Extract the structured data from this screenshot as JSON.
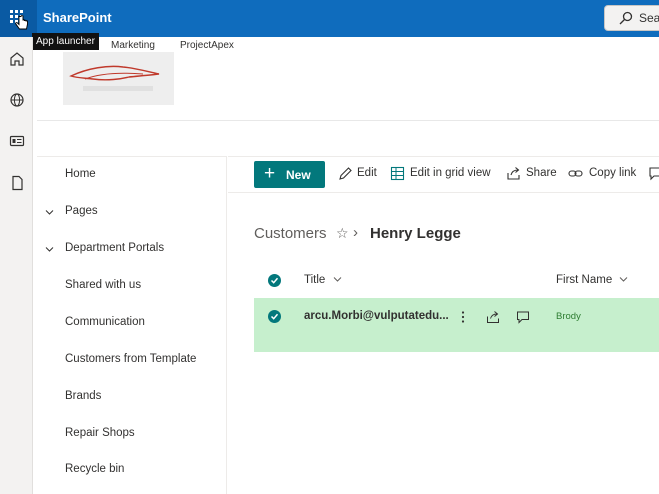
{
  "topbar": {
    "app_name": "SharePoint",
    "search_placeholder": "Sea",
    "tooltip": "App launcher"
  },
  "site_nav": {
    "items": [
      "Marketing",
      "ProjectApex"
    ]
  },
  "left_nav": {
    "items": [
      {
        "label": "Home",
        "expandable": false
      },
      {
        "label": "Pages",
        "expandable": true
      },
      {
        "label": "Department Portals",
        "expandable": true
      },
      {
        "label": "Shared with us",
        "expandable": false
      },
      {
        "label": "Communication",
        "expandable": false
      },
      {
        "label": "Customers from Template",
        "expandable": false
      },
      {
        "label": "Brands",
        "expandable": false
      },
      {
        "label": "Repair Shops",
        "expandable": false
      },
      {
        "label": "Recycle bin",
        "expandable": false
      }
    ]
  },
  "command_bar": {
    "new": "New",
    "edit": "Edit",
    "edit_grid": "Edit in grid view",
    "share": "Share",
    "copy_link": "Copy link"
  },
  "breadcrumb": {
    "list": "Customers",
    "item": "Henry Legge"
  },
  "table": {
    "columns": [
      "Title",
      "First Name"
    ],
    "rows": [
      {
        "title": "arcu.Morbi@vulputatedu...",
        "first_name": "Brody",
        "selected": true
      }
    ]
  },
  "colors": {
    "suite_bar": "#0f6cbd",
    "accent": "#03787c",
    "selected_row": "#c6efcd"
  }
}
